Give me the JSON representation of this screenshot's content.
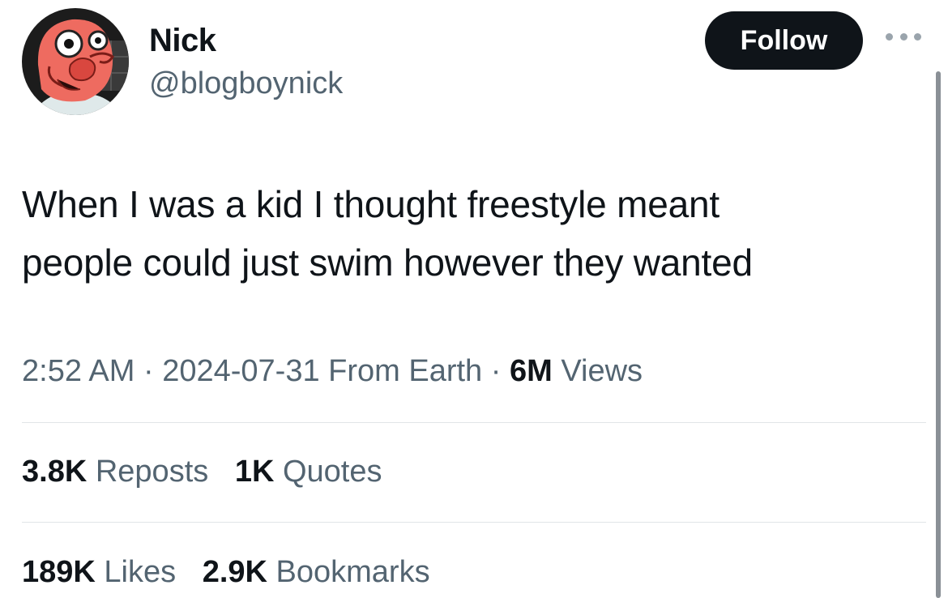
{
  "author": {
    "display_name": "Nick",
    "handle": "@blogboynick",
    "avatar_icon": "cartoon-character-avatar"
  },
  "actions": {
    "follow_label": "Follow",
    "more_icon": "more-options-icon"
  },
  "tweet": {
    "lines": [
      "When I was a kid I thought freestyle meant",
      "people could just swim however they wanted"
    ]
  },
  "meta": {
    "time": "2:52 AM",
    "separator": "·",
    "date": "2024-07-31",
    "location": "From Earth",
    "views_count": "6M",
    "views_label": "Views"
  },
  "stats": {
    "reposts_count": "3.8K",
    "reposts_label": "Reposts",
    "quotes_count": "1K",
    "quotes_label": "Quotes",
    "likes_count": "189K",
    "likes_label": "Likes",
    "bookmarks_count": "2.9K",
    "bookmarks_label": "Bookmarks"
  },
  "colors": {
    "text_primary": "#0f1419",
    "text_secondary": "#536471",
    "button_bg": "#0f1419",
    "divider": "#e1e5e8"
  }
}
